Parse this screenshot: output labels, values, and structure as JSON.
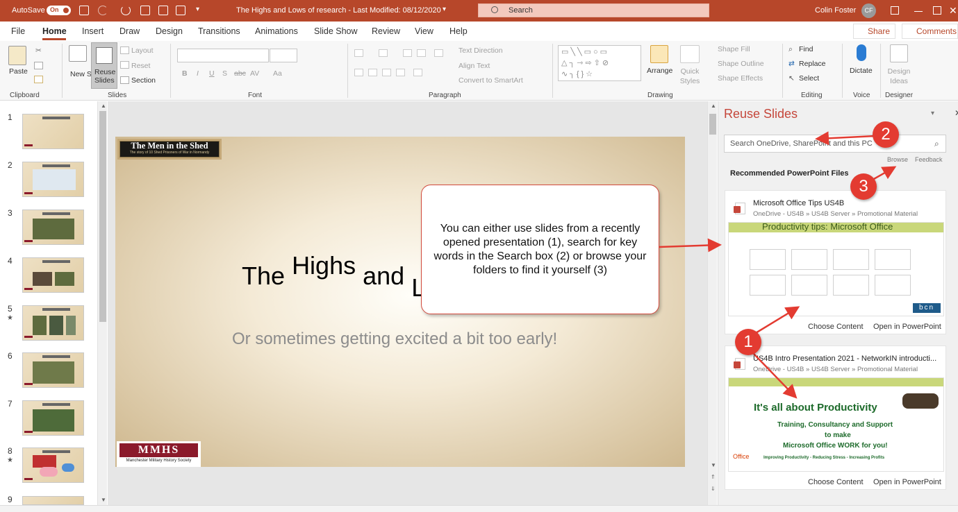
{
  "titlebar": {
    "autosave_label": "AutoSave",
    "autosave_state": "On",
    "document_title": "The Highs and Lows of research  -  Last Modified: 08/12/2020",
    "search_placeholder": "Search",
    "user_name": "Colin Foster",
    "user_initials": "CF",
    "color": "#b7472a"
  },
  "menu": {
    "tabs": [
      "File",
      "Home",
      "Insert",
      "Draw",
      "Design",
      "Transitions",
      "Animations",
      "Slide Show",
      "Review",
      "View",
      "Help"
    ],
    "active": "Home",
    "share_label": "Share",
    "comments_label": "Comments"
  },
  "ribbon": {
    "clipboard": {
      "paste": "Paste",
      "group": "Clipboard"
    },
    "slides": {
      "new_slide": "New Slide",
      "reuse_slides": "Reuse Slides",
      "layout": "Layout",
      "reset": "Reset",
      "section": "Section",
      "group": "Slides"
    },
    "font": {
      "group": "Font",
      "bold": "B",
      "italic": "I",
      "underline": "U",
      "strike": "S",
      "abc": "abc",
      "spacing": "AV",
      "case": "Aa"
    },
    "paragraph": {
      "text_direction": "Text Direction",
      "align_text": "Align Text",
      "convert_smartart": "Convert to SmartArt",
      "group": "Paragraph"
    },
    "drawing": {
      "arrange": "Arrange",
      "quick_styles": "Quick Styles",
      "shape_fill": "Shape Fill",
      "shape_outline": "Shape Outline",
      "shape_effects": "Shape Effects",
      "group": "Drawing"
    },
    "editing": {
      "find": "Find",
      "replace": "Replace",
      "select": "Select",
      "group": "Editing"
    },
    "voice": {
      "dictate": "Dictate",
      "group": "Voice"
    },
    "designer": {
      "design_ideas": "Design Ideas",
      "group": "Designer"
    }
  },
  "thumbnails": [
    {
      "num": "1",
      "star": ""
    },
    {
      "num": "2",
      "star": ""
    },
    {
      "num": "3",
      "star": ""
    },
    {
      "num": "4",
      "star": ""
    },
    {
      "num": "5",
      "star": "★"
    },
    {
      "num": "6",
      "star": ""
    },
    {
      "num": "7",
      "star": ""
    },
    {
      "num": "8",
      "star": "★"
    },
    {
      "num": "9",
      "star": ""
    }
  ],
  "slide": {
    "badge_title": "The Men in the Shed",
    "badge_subtitle": "The story of 10 Shed Prisoners of War in Normandy",
    "title_the": "The",
    "title_highs": "Highs",
    "title_and": "and",
    "title_lo": "Lo",
    "subtitle": "Or sometimes getting excited a bit too early!",
    "logo_letters": "MMHS",
    "logo_caption": "Manchester Military History Society"
  },
  "callout": {
    "text": "You can either use slides from a recently opened presentation (1), search for key words in the Search box (2) or browse your folders to find it yourself (3)"
  },
  "reuse_panel": {
    "title": "Reuse Slides",
    "search_placeholder": "Search OneDrive, SharePoint and this PC",
    "browse": "Browse",
    "feedback": "Feedback",
    "recommended": "Recommended PowerPoint Files",
    "files": [
      {
        "title": "Microsoft Office Tips US4B",
        "path": "OneDrive - US4B » US4B Server » Promotional Material",
        "preview_heading": "Productivity tips: Microsoft Office",
        "preview_brand": "bcn",
        "choose": "Choose Content",
        "open": "Open in PowerPoint"
      },
      {
        "title": "US4B Intro Presentation 2021 - NetworkIN introducti...",
        "path": "OneDrive - US4B » US4B Server » Promotional Material",
        "preview_heading": "It's all about Productivity",
        "preview_line1": "Training, Consultancy and Support",
        "preview_line2": "to make",
        "preview_line3": "Microsoft Office WORK for you!",
        "preview_footer": "Improving Productivity - Reducing Stress - Increasing Profits",
        "preview_office": "Office",
        "choose": "Choose Content",
        "open": "Open in PowerPoint"
      }
    ]
  },
  "annotations": {
    "badge1": "1",
    "badge2": "2",
    "badge3": "3",
    "color": "#e33b31"
  }
}
